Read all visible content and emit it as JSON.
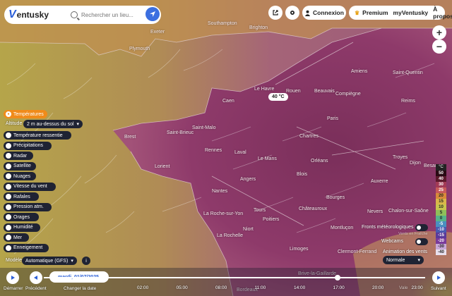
{
  "app": {
    "logo_v": "V",
    "logo_name": "entusky"
  },
  "search": {
    "placeholder": "Rechercher un lieu..."
  },
  "top": {
    "login": "Connexion",
    "premium": "Premium",
    "myventusky": "myVentusky",
    "about": "À propos"
  },
  "zoom": {
    "in": "+",
    "out": "−"
  },
  "layers": {
    "active": "Températures",
    "items": [
      "Température ressentie",
      "Précipitations",
      "Radar",
      "Satellite",
      "Nuages",
      "Vitesse du vent",
      "Rafales",
      "Pression atm.",
      "Orages",
      "Humidité",
      "Mer",
      "Enneigement"
    ]
  },
  "altitude": {
    "label": "Altitude",
    "value": "2 m au-dessus du sol"
  },
  "model": {
    "label": "Modèle",
    "value": "Automatique (GFS)",
    "info": "i"
  },
  "bubble": "40 °C",
  "cities": [
    {
      "name": "Exeter"
    },
    {
      "name": "Southampton"
    },
    {
      "name": "Brighton"
    },
    {
      "name": "Plymouth"
    },
    {
      "name": "Le Havre"
    },
    {
      "name": "Rouen"
    },
    {
      "name": "Beauvais"
    },
    {
      "name": "Amiens"
    },
    {
      "name": "Saint-Quentin"
    },
    {
      "name": "Compiègne"
    },
    {
      "name": "Paris"
    },
    {
      "name": "Caen"
    },
    {
      "name": "Brest"
    },
    {
      "name": "Saint-Brieuc"
    },
    {
      "name": "Saint-Malo"
    },
    {
      "name": "Rennes"
    },
    {
      "name": "Laval"
    },
    {
      "name": "Le Mans"
    },
    {
      "name": "Chartres"
    },
    {
      "name": "Troyes"
    },
    {
      "name": "Lorient"
    },
    {
      "name": "Orléans"
    },
    {
      "name": "Angers"
    },
    {
      "name": "Tours"
    },
    {
      "name": "Blois"
    },
    {
      "name": "Nantes"
    },
    {
      "name": "Auxerre"
    },
    {
      "name": "Bourges"
    },
    {
      "name": "Niort"
    },
    {
      "name": "Poitiers"
    },
    {
      "name": "Châteauroux"
    },
    {
      "name": "Nevers"
    },
    {
      "name": "La Roche-sur-Yon"
    },
    {
      "name": "La Rochelle"
    },
    {
      "name": "Montluçon"
    },
    {
      "name": "Limoges"
    },
    {
      "name": "Clermont-Ferrand"
    },
    {
      "name": "Brive-la-Gaillarde"
    },
    {
      "name": "Dijon"
    },
    {
      "name": "Chalon-sur-Saône"
    },
    {
      "name": "Besançon"
    },
    {
      "name": "Reims"
    },
    {
      "name": "Bordeaux"
    }
  ],
  "legend": {
    "unit": "°C",
    "items": [
      {
        "v": "50",
        "c": "#2a0a14",
        "t": "#fff"
      },
      {
        "v": "40",
        "c": "#5c1a2c",
        "t": "#fff"
      },
      {
        "v": "30",
        "c": "#a23a56",
        "t": "#fff"
      },
      {
        "v": "25",
        "c": "#c85a5a",
        "t": "#fff"
      },
      {
        "v": "20",
        "c": "#d88a3a",
        "t": "#222"
      },
      {
        "v": "15",
        "c": "#d9b64a",
        "t": "#222"
      },
      {
        "v": "10",
        "c": "#c8c44e",
        "t": "#222"
      },
      {
        "v": "5",
        "c": "#8fbf5a",
        "t": "#222"
      },
      {
        "v": "0",
        "c": "#56b38a",
        "t": "#222"
      },
      {
        "v": "-5",
        "c": "#4a8fc0",
        "t": "#fff"
      },
      {
        "v": "-10",
        "c": "#4a5ab0",
        "t": "#fff"
      },
      {
        "v": "-15",
        "c": "#5a3a9a",
        "t": "#fff"
      },
      {
        "v": "-20",
        "c": "#7a3a9a",
        "t": "#fff"
      },
      {
        "v": "-30",
        "c": "#c8a8d8",
        "t": "#222"
      },
      {
        "v": "-40",
        "c": "#e8e0ee",
        "t": "#222"
      }
    ]
  },
  "right": {
    "fronts": "Fronts météorologiques",
    "webcams": "Webcams",
    "anim_label": "Animation des vents",
    "anim_value": "Normale",
    "faded": "Vents en Fraîche"
  },
  "timeline": {
    "play": "Démarrer",
    "prev": "Précédent",
    "change_date": "Changer la date",
    "next": "Suivant",
    "date": "mardi, 01/07/2025",
    "ticks": [
      "02:00",
      "05:00",
      "08:00",
      "11:00",
      "14:00",
      "17:00",
      "20:00",
      "23:00"
    ],
    "value_label": "Vale",
    "current_hour": 17
  },
  "colors": {
    "accent": "#f08b1a",
    "panel": "#1f2333",
    "brand": "#2b5fd8"
  }
}
